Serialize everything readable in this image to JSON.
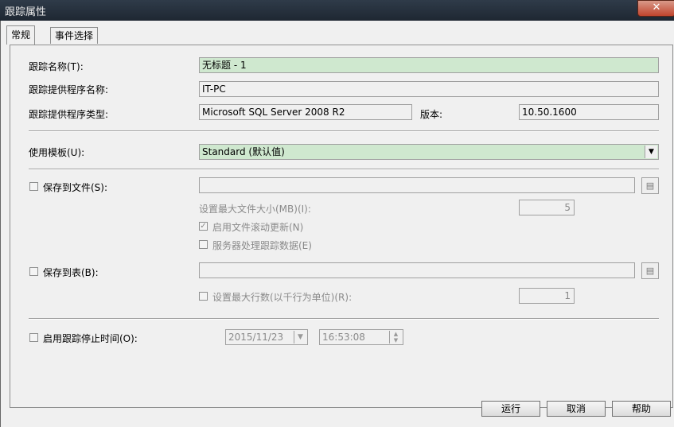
{
  "window": {
    "title": "跟踪属性",
    "close_glyph": "✕"
  },
  "tabs": [
    "常规",
    "事件选择"
  ],
  "general": {
    "trace_name_label": "跟踪名称(T):",
    "trace_name_value": "无标题 - 1",
    "provider_name_label": "跟踪提供程序名称:",
    "provider_name_value": "IT-PC",
    "provider_type_label": "跟踪提供程序类型:",
    "provider_type_value": "Microsoft SQL Server 2008 R2",
    "version_label": "版本:",
    "version_value": "10.50.1600",
    "template_label": "使用模板(U):",
    "template_value": "Standard (默认值)",
    "save_to_file_label": "保存到文件(S):",
    "save_to_file_value": "",
    "max_file_size_label": "设置最大文件大小(MB)(I):",
    "max_file_size_value": "5",
    "file_rollover_label": "启用文件滚动更新(N)",
    "file_rollover_checked": true,
    "server_process_label": "服务器处理跟踪数据(E)",
    "server_process_checked": false,
    "save_to_table_label": "保存到表(B):",
    "save_to_table_value": "",
    "max_rows_label": "设置最大行数(以千行为单位)(R):",
    "max_rows_value": "1",
    "stop_time_label": "启用跟踪停止时间(O):",
    "stop_date_value": "2015/11/23",
    "stop_time_value": "16:53:08"
  },
  "buttons": {
    "run": "运行",
    "cancel": "取消",
    "help": "帮助"
  },
  "colors": {
    "highlight_field": "#cfe8cf",
    "dialog_bg": "#f0f0f0"
  }
}
